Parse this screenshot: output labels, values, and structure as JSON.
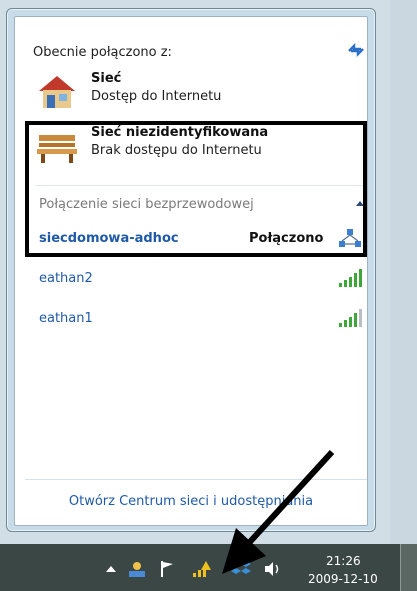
{
  "flyout": {
    "header_label": "Obecnie połączono z:",
    "networks": [
      {
        "name": "Sieć",
        "status": "Dostęp do Internetu",
        "icon": "home-network-icon"
      },
      {
        "name": "Sieć niezidentyfikowana",
        "status": "Brak dostępu do Internetu",
        "icon": "public-bench-icon"
      }
    ],
    "wireless_section": {
      "header": "Połączenie sieci bezprzewodowej",
      "items": [
        {
          "ssid": "siecdomowa-adhoc",
          "status": "Połączono",
          "icon": "adhoc-network-icon",
          "signal": null
        },
        {
          "ssid": "eathan2",
          "status": "",
          "icon": "signal-strength-icon",
          "signal": 5
        },
        {
          "ssid": "eathan1",
          "status": "",
          "icon": "signal-strength-icon",
          "signal": 4
        }
      ]
    },
    "footer_link": "Otwórz Centrum sieci i udostępniania"
  },
  "taskbar": {
    "time": "21:26",
    "date": "2009-12-10",
    "tray_icons": [
      "show-hidden-icon",
      "network-share-icon",
      "action-center-flag-icon",
      "network-warning-icon",
      "dropbox-icon",
      "volume-icon"
    ]
  },
  "colors": {
    "link": "#1f5aa8",
    "taskbar": "#3a4744",
    "frame": "#c7dbe8"
  }
}
